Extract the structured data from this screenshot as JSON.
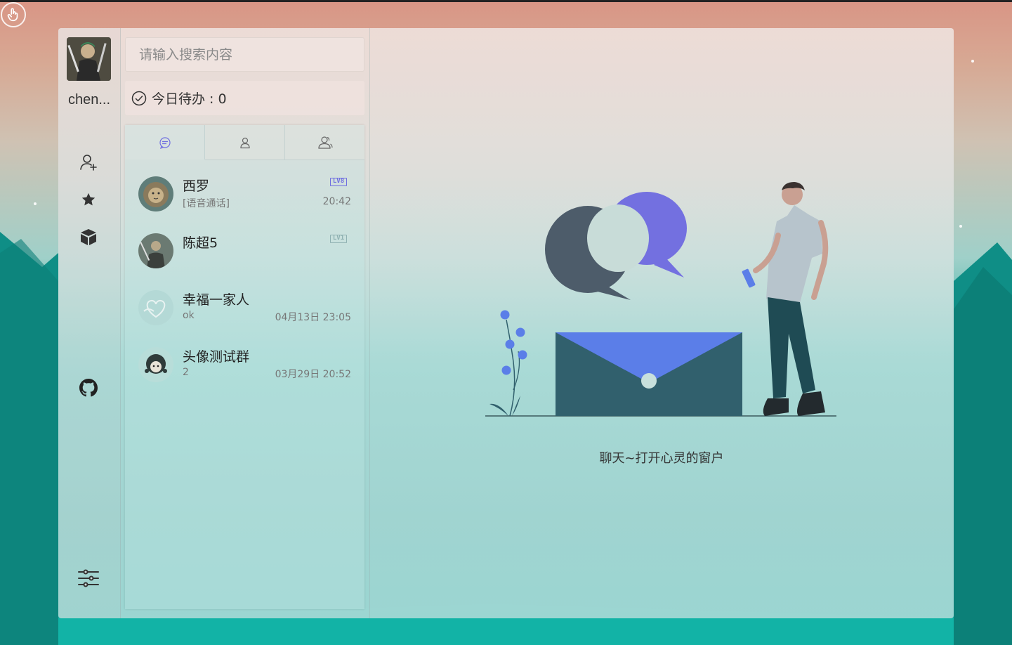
{
  "user": {
    "name": "chen..."
  },
  "sidebar": {
    "icons": [
      "add-friend-icon",
      "star-icon",
      "cube-icon",
      "github-icon",
      "settings-sliders-icon"
    ]
  },
  "search": {
    "placeholder": "请输入搜索内容"
  },
  "todo": {
    "label": "今日待办 : 0"
  },
  "tabs": [
    "chat-bubble-icon",
    "user-icon",
    "group-icon"
  ],
  "sessions": [
    {
      "name": "西罗",
      "last": "[语音通话]",
      "time": "20:42",
      "badge": "LV8",
      "badge_color": "#6f6ee0"
    },
    {
      "name": "陈超5",
      "last": "",
      "time": "",
      "badge": "LV1",
      "badge_color": "#8fb1b2"
    },
    {
      "name": "幸福一家人",
      "last": "ok",
      "time": "04月13日 23:05",
      "badge": "",
      "badge_color": ""
    },
    {
      "name": "头像测试群",
      "last": "2",
      "time": "03月29日 20:52",
      "badge": "",
      "badge_color": ""
    }
  ],
  "main": {
    "welcome": "聊天~打开心灵的窗户"
  },
  "colors": {
    "accent": "#6f6ee0",
    "dark_bubble": "#4a5a66",
    "envelope": "#2e5e6b",
    "envelope_flap": "#5b7ee8"
  }
}
